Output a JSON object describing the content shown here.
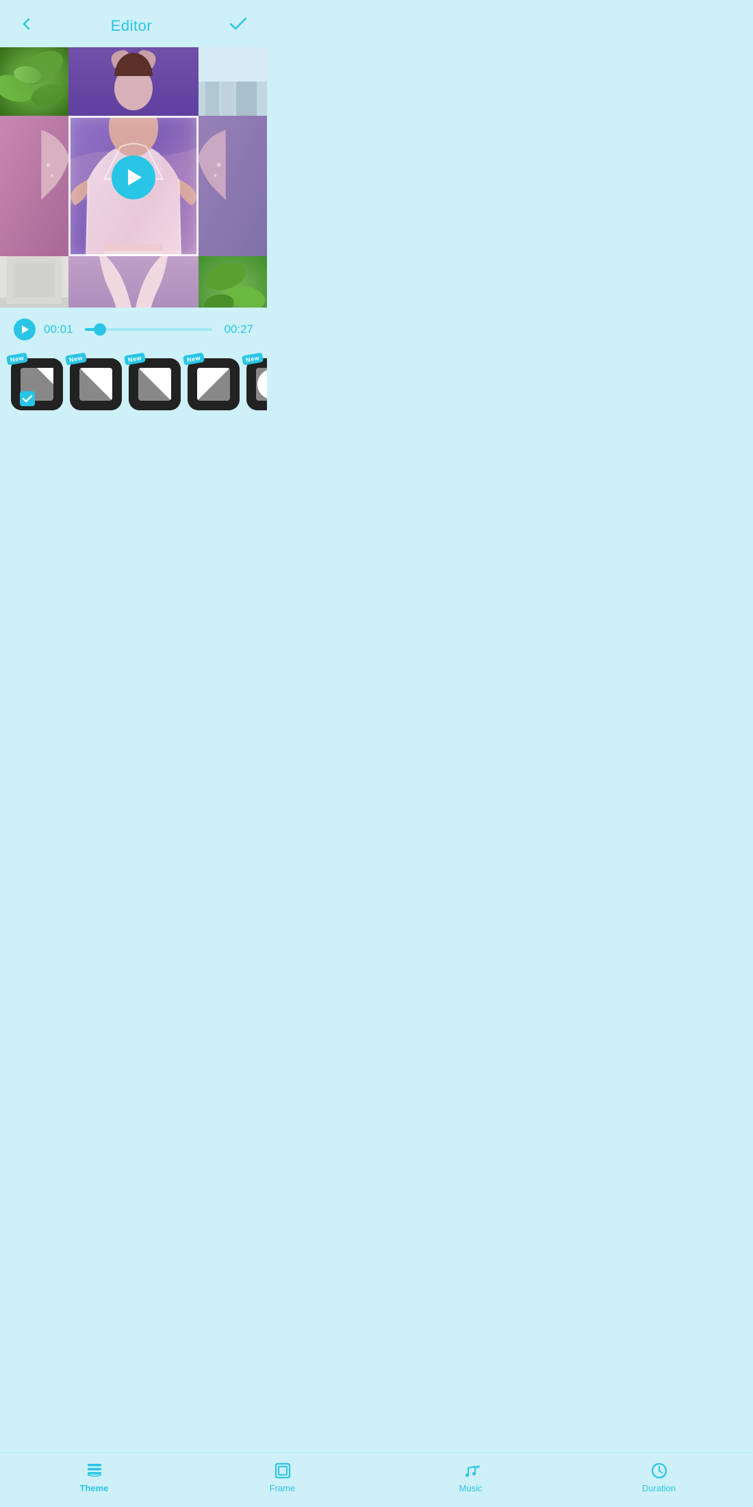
{
  "app": {
    "title": "Editor"
  },
  "header": {
    "back_label": "‹",
    "title": "Editor",
    "confirm_label": "✓"
  },
  "timeline": {
    "current_time": "00:01",
    "total_time": "00:27",
    "progress_percent": 4
  },
  "transitions": [
    {
      "id": 0,
      "badge": "New",
      "selected": true,
      "shape": "diagonal_small",
      "label": "transition-0"
    },
    {
      "id": 1,
      "badge": "New",
      "selected": false,
      "shape": "diagonal_top_right",
      "label": "transition-1"
    },
    {
      "id": 2,
      "badge": "New",
      "selected": false,
      "shape": "diagonal_bottom_left",
      "label": "transition-2"
    },
    {
      "id": 3,
      "badge": "New",
      "selected": false,
      "shape": "diagonal_large",
      "label": "transition-3"
    },
    {
      "id": 4,
      "badge": "New",
      "selected": false,
      "shape": "circle",
      "label": "transition-4"
    }
  ],
  "bottom_nav": {
    "items": [
      {
        "id": "theme",
        "label": "Theme",
        "icon": "layers",
        "active": true
      },
      {
        "id": "frame",
        "label": "Frame",
        "icon": "frame",
        "active": false
      },
      {
        "id": "music",
        "label": "Music",
        "icon": "music",
        "active": false
      },
      {
        "id": "duration",
        "label": "Duration",
        "icon": "clock",
        "active": false
      }
    ]
  },
  "colors": {
    "primary": "#29c5e6",
    "background": "#cef0f8",
    "dark": "#1a120a",
    "white": "#ffffff"
  },
  "badges": {
    "new": "New"
  }
}
